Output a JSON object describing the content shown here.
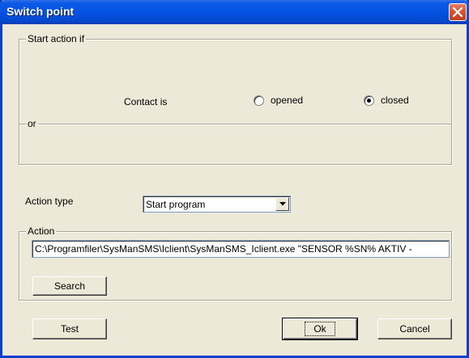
{
  "window": {
    "title": "Switch point"
  },
  "start_group": {
    "legend": "Start action if",
    "or_label": "or",
    "contact_label": "Contact is",
    "options": [
      {
        "label": "opened",
        "checked": false
      },
      {
        "label": "closed",
        "checked": true
      }
    ]
  },
  "action_type": {
    "label": "Action type",
    "selected": "Start program"
  },
  "action_group": {
    "legend": "Action",
    "value": "C:\\Programfiler\\SysManSMS\\Iclient\\SysManSMS_Iclient.exe \"SENSOR %SN% AKTIV -",
    "search_label": "Search"
  },
  "buttons": {
    "test": "Test",
    "ok": "Ok",
    "cancel": "Cancel"
  }
}
